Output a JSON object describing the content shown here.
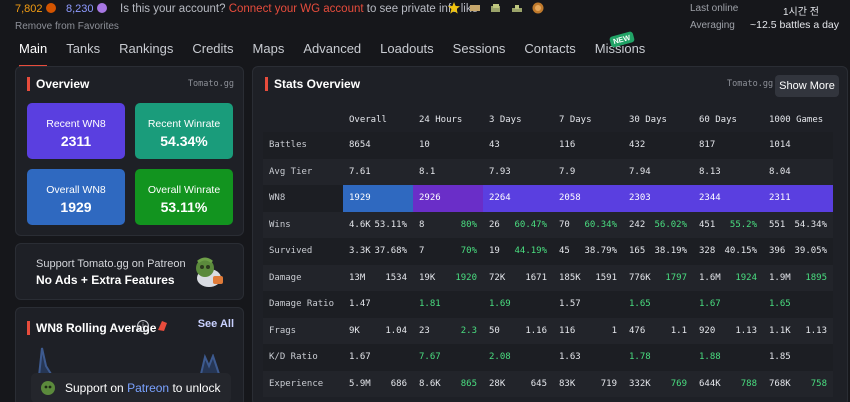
{
  "header": {
    "gold": "7,802",
    "silver": "8,230",
    "remove_favorites": "Remove from Favorites",
    "account_prefix": "Is this your account?",
    "account_link": "Connect your WG account",
    "account_suffix": "to see private info like",
    "last_online_label": "Last online",
    "last_online_value": "1시간 전",
    "averaging_label": "Averaging",
    "averaging_value": "~12.5 battles a day"
  },
  "nav": {
    "tabs": [
      "Main",
      "Tanks",
      "Rankings",
      "Credits",
      "Maps",
      "Advanced",
      "Loadouts",
      "Sessions",
      "Contacts",
      "Missions"
    ],
    "active": "Main",
    "new_badge": "NEW"
  },
  "overview": {
    "title": "Overview",
    "credit": "Tomato.gg",
    "cards": [
      {
        "label": "Recent WN8",
        "value": "2311",
        "color": "#5a3fe0"
      },
      {
        "label": "Recent Winrate",
        "value": "54.34%",
        "color": "#1a9c7b"
      },
      {
        "label": "Overall WN8",
        "value": "1929",
        "color": "#2f69c0"
      },
      {
        "label": "Overall Winrate",
        "value": "53.11%",
        "color": "#12941f"
      }
    ]
  },
  "patreon": {
    "line1": "Support Tomato.gg on Patreon",
    "line2": "No Ads + Extra Features"
  },
  "rolling": {
    "title": "WN8 Rolling Average",
    "see_all": "See All",
    "support_prefix": "Support on",
    "support_link": "Patreon",
    "support_suffix": "to unlock"
  },
  "stats": {
    "title": "Stats Overview",
    "credit": "Tomato.gg",
    "show_more": "Show More",
    "columns": [
      "Overall",
      "24 Hours",
      "3 Days",
      "7 Days",
      "30 Days",
      "60 Days",
      "1000 Games"
    ],
    "wn8_colors": [
      "#2f69c0",
      "#6a2ec8",
      "#5a3fe0",
      "#5a3fe0",
      "#5a3fe0",
      "#5a3fe0",
      "#5a3fe0"
    ],
    "rows": [
      {
        "label": "Battles",
        "cells": [
          [
            "8654"
          ],
          [
            "10"
          ],
          [
            "43"
          ],
          [
            "116"
          ],
          [
            "432"
          ],
          [
            "817"
          ],
          [
            "1014"
          ]
        ]
      },
      {
        "label": "Avg Tier",
        "cells": [
          [
            "7.61"
          ],
          [
            "8.1"
          ],
          [
            "7.93"
          ],
          [
            "7.9"
          ],
          [
            "7.94"
          ],
          [
            "8.13"
          ],
          [
            "8.04"
          ]
        ]
      },
      {
        "label": "WN8",
        "cells": [
          [
            "1929"
          ],
          [
            "2926"
          ],
          [
            "2264"
          ],
          [
            "2058"
          ],
          [
            "2303"
          ],
          [
            "2344"
          ],
          [
            "2311"
          ]
        ]
      },
      {
        "label": "Wins",
        "cells": [
          [
            "4.6K",
            "53.11%"
          ],
          [
            "8",
            "80%"
          ],
          [
            "26",
            "60.47%"
          ],
          [
            "70",
            "60.34%"
          ],
          [
            "242",
            "56.02%"
          ],
          [
            "451",
            "55.2%"
          ],
          [
            "551",
            "54.34%"
          ]
        ]
      },
      {
        "label": "Survived",
        "cells": [
          [
            "3.3K",
            "37.68%"
          ],
          [
            "7",
            "70%"
          ],
          [
            "19",
            "44.19%"
          ],
          [
            "45",
            "38.79%"
          ],
          [
            "165",
            "38.19%"
          ],
          [
            "328",
            "40.15%"
          ],
          [
            "396",
            "39.05%"
          ]
        ]
      },
      {
        "label": "Damage",
        "cells": [
          [
            "13M",
            "1534"
          ],
          [
            "19K",
            "1920"
          ],
          [
            "72K",
            "1671"
          ],
          [
            "185K",
            "1591"
          ],
          [
            "776K",
            "1797"
          ],
          [
            "1.6M",
            "1924"
          ],
          [
            "1.9M",
            "1895"
          ]
        ]
      },
      {
        "label": "Damage Ratio",
        "cells": [
          [
            "1.47"
          ],
          [
            "1.81"
          ],
          [
            "1.69"
          ],
          [
            "1.57"
          ],
          [
            "1.65"
          ],
          [
            "1.67"
          ],
          [
            "1.65"
          ]
        ]
      },
      {
        "label": "Frags",
        "cells": [
          [
            "9K",
            "1.04"
          ],
          [
            "23",
            "2.3"
          ],
          [
            "50",
            "1.16"
          ],
          [
            "116",
            "1"
          ],
          [
            "476",
            "1.1"
          ],
          [
            "920",
            "1.13"
          ],
          [
            "1.1K",
            "1.13"
          ]
        ]
      },
      {
        "label": "K/D Ratio",
        "cells": [
          [
            "1.67"
          ],
          [
            "7.67"
          ],
          [
            "2.08"
          ],
          [
            "1.63"
          ],
          [
            "1.78"
          ],
          [
            "1.88"
          ],
          [
            "1.85"
          ]
        ]
      },
      {
        "label": "Experience",
        "cells": [
          [
            "5.9M",
            "686"
          ],
          [
            "8.6K",
            "865"
          ],
          [
            "28K",
            "645"
          ],
          [
            "83K",
            "719"
          ],
          [
            "332K",
            "769"
          ],
          [
            "644K",
            "788"
          ],
          [
            "768K",
            "758"
          ]
        ]
      }
    ],
    "green_cells": {
      "Wins": [
        1,
        2,
        3,
        4,
        5
      ],
      "Survived": [
        1,
        2
      ],
      "Damage": [
        1,
        4,
        5,
        6
      ],
      "Damage Ratio": [
        1,
        2,
        4,
        5,
        6
      ],
      "Frags": [
        1
      ],
      "K/D Ratio": [
        1,
        2,
        4,
        5
      ],
      "Experience": [
        1,
        4,
        5,
        6
      ]
    }
  }
}
